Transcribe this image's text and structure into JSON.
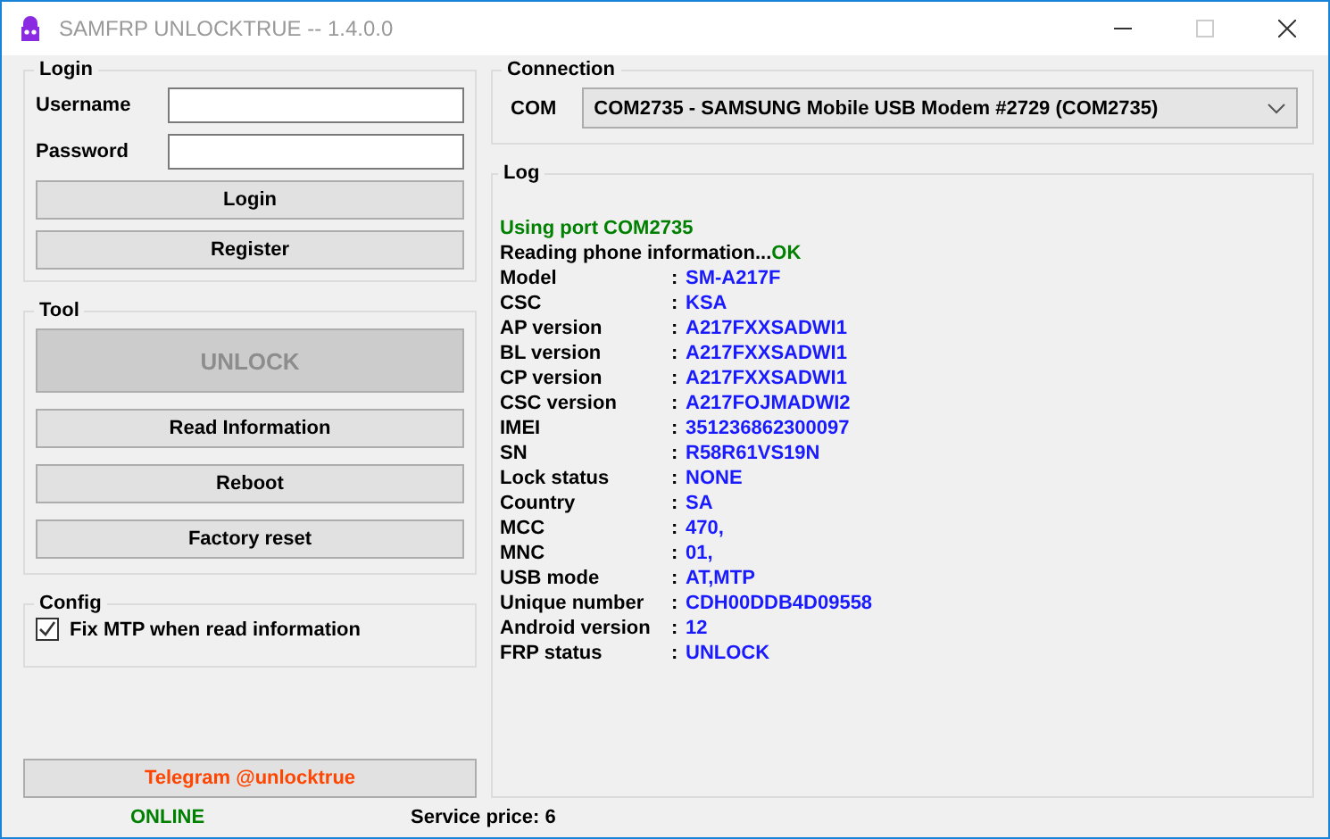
{
  "window": {
    "title": "SAMFRP UNLOCKTRUE -- 1.4.0.0"
  },
  "login": {
    "title": "Login",
    "fields": [
      {
        "label": "Username"
      },
      {
        "label": "Password"
      }
    ],
    "buttons": [
      {
        "label": "Login",
        "disabled": false
      },
      {
        "label": "Register",
        "disabled": false
      }
    ]
  },
  "tool": {
    "title": "Tool",
    "buttons": [
      {
        "label": "UNLOCK",
        "disabled": true,
        "kind": "large"
      },
      {
        "label": "Read Information",
        "disabled": false,
        "kind": "normal"
      },
      {
        "label": "Reboot",
        "disabled": false,
        "kind": "normal"
      },
      {
        "label": "Factory reset",
        "disabled": false,
        "kind": "normal"
      }
    ]
  },
  "config": {
    "title": "Config",
    "options": [
      {
        "label": "Fix MTP when read information",
        "checked": true
      }
    ]
  },
  "telegram_button": {
    "label": "Telegram @unlocktrue"
  },
  "connection": {
    "title": "Connection",
    "label": "COM",
    "value": "COM2735 - SAMSUNG Mobile USB Modem #2729 (COM2735)"
  },
  "log": {
    "title": "Log",
    "lines": [
      {
        "kind": "message",
        "parts": [
          {
            "text": "Using port COM2735",
            "color": "#008000"
          }
        ]
      },
      {
        "kind": "message",
        "parts": [
          {
            "text": "Reading phone information...",
            "color": "#000000"
          },
          {
            "text": "OK",
            "color": "#008000"
          }
        ]
      },
      {
        "kind": "field",
        "label": "Model",
        "separator": ":",
        "value": "SM-A217F"
      },
      {
        "kind": "field",
        "label": "CSC",
        "separator": ":",
        "value": "KSA"
      },
      {
        "kind": "field",
        "label": "AP version",
        "separator": ":",
        "value": "A217FXXSADWI1"
      },
      {
        "kind": "field",
        "label": "BL version",
        "separator": ":",
        "value": "A217FXXSADWI1"
      },
      {
        "kind": "field",
        "label": "CP version",
        "separator": ":",
        "value": "A217FXXSADWI1"
      },
      {
        "kind": "field",
        "label": "CSC version",
        "separator": ":",
        "value": "A217FOJMADWI2"
      },
      {
        "kind": "field",
        "label": "IMEI",
        "separator": ":",
        "value": "351236862300097"
      },
      {
        "kind": "field",
        "label": "SN",
        "separator": ":",
        "value": "R58R61VS19N"
      },
      {
        "kind": "field",
        "label": "Lock status",
        "separator": ":",
        "value": "NONE"
      },
      {
        "kind": "field",
        "label": "Country",
        "separator": ":",
        "value": "SA"
      },
      {
        "kind": "field",
        "label": "MCC",
        "separator": ":",
        "value": "470,"
      },
      {
        "kind": "field",
        "label": "MNC",
        "separator": ":",
        "value": "01,"
      },
      {
        "kind": "field",
        "label": "USB mode",
        "separator": ":",
        "value": "AT,MTP"
      },
      {
        "kind": "field",
        "label": "Unique number",
        "separator": ":",
        "value": "CDH00DDB4D09558"
      },
      {
        "kind": "field",
        "label": "Android version",
        "separator": ":",
        "value": "12"
      },
      {
        "kind": "field",
        "label": "FRP status",
        "separator": ":",
        "value": "UNLOCK"
      }
    ]
  },
  "status_bar": {
    "status": "ONLINE",
    "online": true,
    "price": "Service price: 6"
  }
}
